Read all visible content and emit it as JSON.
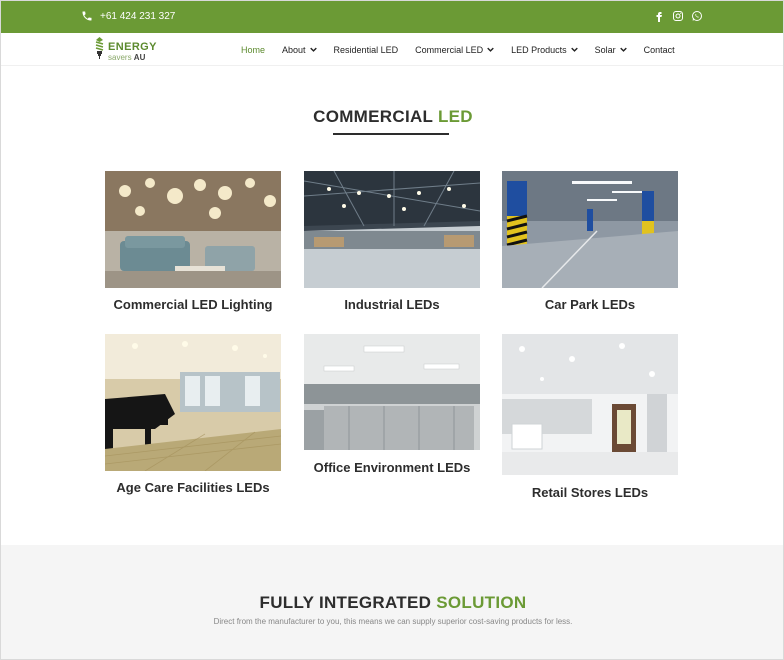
{
  "topbar": {
    "phone": "+61 424 231 327",
    "socials": [
      "facebook-icon",
      "instagram-icon",
      "whatsapp-icon"
    ],
    "bg_color": "#6b9a35"
  },
  "nav": {
    "logo": {
      "main": "ENERGY",
      "sub": "savers",
      "sub_bold": "AU"
    },
    "menu": [
      {
        "label": "Home",
        "active": true,
        "dropdown": false
      },
      {
        "label": "About",
        "active": false,
        "dropdown": true
      },
      {
        "label": "Residential LED",
        "active": false,
        "dropdown": false
      },
      {
        "label": "Commercial LED",
        "active": false,
        "dropdown": true
      },
      {
        "label": "LED Products",
        "active": false,
        "dropdown": true
      },
      {
        "label": "Solar",
        "active": false,
        "dropdown": true
      },
      {
        "label": "Contact",
        "active": false,
        "dropdown": false
      }
    ]
  },
  "section": {
    "title_main": "COMMERCIAL",
    "title_accent": "LED"
  },
  "cards": [
    {
      "title": "Commercial LED Lighting"
    },
    {
      "title": "Industrial LEDs"
    },
    {
      "title": "Car Park LEDs"
    },
    {
      "title": "Age Care Facilities LEDs"
    },
    {
      "title": "Office Environment LEDs"
    },
    {
      "title": "Retail Stores LEDs"
    }
  ],
  "bottom": {
    "title_main": "FULLY INTEGRATED",
    "title_accent": "SOLUTION",
    "subtitle": "Direct from the manufacturer to you, this means we can supply superior cost-saving products for less."
  },
  "colors": {
    "accent": "#6b9a35",
    "heading": "#2d2d2d"
  }
}
